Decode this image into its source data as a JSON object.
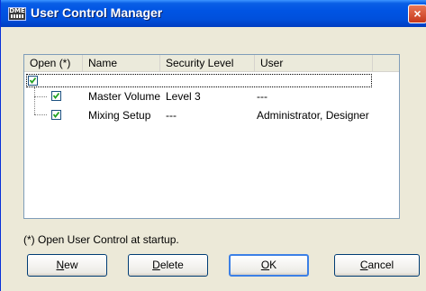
{
  "window": {
    "title": "User Control Manager",
    "app_icon_text": "DME",
    "close_label": "×"
  },
  "list": {
    "columns": [
      "Open (*)",
      "Name",
      "Security Level",
      "User"
    ],
    "root_checked": true,
    "rows": [
      {
        "checked": true,
        "name": "Master Volume",
        "security_level": "Level 3",
        "user": "---"
      },
      {
        "checked": true,
        "name": "Mixing Setup",
        "security_level": "---",
        "user": "Administrator, Designer"
      }
    ]
  },
  "footnote": "(*) Open User Control at startup.",
  "buttons": {
    "new": {
      "mnemonic": "N",
      "rest": "ew"
    },
    "delete": {
      "mnemonic": "D",
      "rest": "elete"
    },
    "ok": {
      "mnemonic": "O",
      "rest": "K"
    },
    "cancel": {
      "mnemonic": "C",
      "rest": "ancel"
    }
  }
}
